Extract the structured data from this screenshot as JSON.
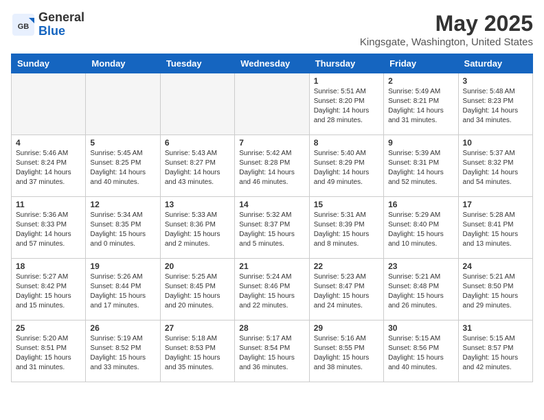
{
  "logo": {
    "general": "General",
    "blue": "Blue"
  },
  "header": {
    "title": "May 2025",
    "location": "Kingsgate, Washington, United States"
  },
  "days_of_week": [
    "Sunday",
    "Monday",
    "Tuesday",
    "Wednesday",
    "Thursday",
    "Friday",
    "Saturday"
  ],
  "weeks": [
    [
      {
        "day": "",
        "info": ""
      },
      {
        "day": "",
        "info": ""
      },
      {
        "day": "",
        "info": ""
      },
      {
        "day": "",
        "info": ""
      },
      {
        "day": "1",
        "info": "Sunrise: 5:51 AM\nSunset: 8:20 PM\nDaylight: 14 hours\nand 28 minutes."
      },
      {
        "day": "2",
        "info": "Sunrise: 5:49 AM\nSunset: 8:21 PM\nDaylight: 14 hours\nand 31 minutes."
      },
      {
        "day": "3",
        "info": "Sunrise: 5:48 AM\nSunset: 8:23 PM\nDaylight: 14 hours\nand 34 minutes."
      }
    ],
    [
      {
        "day": "4",
        "info": "Sunrise: 5:46 AM\nSunset: 8:24 PM\nDaylight: 14 hours\nand 37 minutes."
      },
      {
        "day": "5",
        "info": "Sunrise: 5:45 AM\nSunset: 8:25 PM\nDaylight: 14 hours\nand 40 minutes."
      },
      {
        "day": "6",
        "info": "Sunrise: 5:43 AM\nSunset: 8:27 PM\nDaylight: 14 hours\nand 43 minutes."
      },
      {
        "day": "7",
        "info": "Sunrise: 5:42 AM\nSunset: 8:28 PM\nDaylight: 14 hours\nand 46 minutes."
      },
      {
        "day": "8",
        "info": "Sunrise: 5:40 AM\nSunset: 8:29 PM\nDaylight: 14 hours\nand 49 minutes."
      },
      {
        "day": "9",
        "info": "Sunrise: 5:39 AM\nSunset: 8:31 PM\nDaylight: 14 hours\nand 52 minutes."
      },
      {
        "day": "10",
        "info": "Sunrise: 5:37 AM\nSunset: 8:32 PM\nDaylight: 14 hours\nand 54 minutes."
      }
    ],
    [
      {
        "day": "11",
        "info": "Sunrise: 5:36 AM\nSunset: 8:33 PM\nDaylight: 14 hours\nand 57 minutes."
      },
      {
        "day": "12",
        "info": "Sunrise: 5:34 AM\nSunset: 8:35 PM\nDaylight: 15 hours\nand 0 minutes."
      },
      {
        "day": "13",
        "info": "Sunrise: 5:33 AM\nSunset: 8:36 PM\nDaylight: 15 hours\nand 2 minutes."
      },
      {
        "day": "14",
        "info": "Sunrise: 5:32 AM\nSunset: 8:37 PM\nDaylight: 15 hours\nand 5 minutes."
      },
      {
        "day": "15",
        "info": "Sunrise: 5:31 AM\nSunset: 8:39 PM\nDaylight: 15 hours\nand 8 minutes."
      },
      {
        "day": "16",
        "info": "Sunrise: 5:29 AM\nSunset: 8:40 PM\nDaylight: 15 hours\nand 10 minutes."
      },
      {
        "day": "17",
        "info": "Sunrise: 5:28 AM\nSunset: 8:41 PM\nDaylight: 15 hours\nand 13 minutes."
      }
    ],
    [
      {
        "day": "18",
        "info": "Sunrise: 5:27 AM\nSunset: 8:42 PM\nDaylight: 15 hours\nand 15 minutes."
      },
      {
        "day": "19",
        "info": "Sunrise: 5:26 AM\nSunset: 8:44 PM\nDaylight: 15 hours\nand 17 minutes."
      },
      {
        "day": "20",
        "info": "Sunrise: 5:25 AM\nSunset: 8:45 PM\nDaylight: 15 hours\nand 20 minutes."
      },
      {
        "day": "21",
        "info": "Sunrise: 5:24 AM\nSunset: 8:46 PM\nDaylight: 15 hours\nand 22 minutes."
      },
      {
        "day": "22",
        "info": "Sunrise: 5:23 AM\nSunset: 8:47 PM\nDaylight: 15 hours\nand 24 minutes."
      },
      {
        "day": "23",
        "info": "Sunrise: 5:21 AM\nSunset: 8:48 PM\nDaylight: 15 hours\nand 26 minutes."
      },
      {
        "day": "24",
        "info": "Sunrise: 5:21 AM\nSunset: 8:50 PM\nDaylight: 15 hours\nand 29 minutes."
      }
    ],
    [
      {
        "day": "25",
        "info": "Sunrise: 5:20 AM\nSunset: 8:51 PM\nDaylight: 15 hours\nand 31 minutes."
      },
      {
        "day": "26",
        "info": "Sunrise: 5:19 AM\nSunset: 8:52 PM\nDaylight: 15 hours\nand 33 minutes."
      },
      {
        "day": "27",
        "info": "Sunrise: 5:18 AM\nSunset: 8:53 PM\nDaylight: 15 hours\nand 35 minutes."
      },
      {
        "day": "28",
        "info": "Sunrise: 5:17 AM\nSunset: 8:54 PM\nDaylight: 15 hours\nand 36 minutes."
      },
      {
        "day": "29",
        "info": "Sunrise: 5:16 AM\nSunset: 8:55 PM\nDaylight: 15 hours\nand 38 minutes."
      },
      {
        "day": "30",
        "info": "Sunrise: 5:15 AM\nSunset: 8:56 PM\nDaylight: 15 hours\nand 40 minutes."
      },
      {
        "day": "31",
        "info": "Sunrise: 5:15 AM\nSunset: 8:57 PM\nDaylight: 15 hours\nand 42 minutes."
      }
    ]
  ]
}
